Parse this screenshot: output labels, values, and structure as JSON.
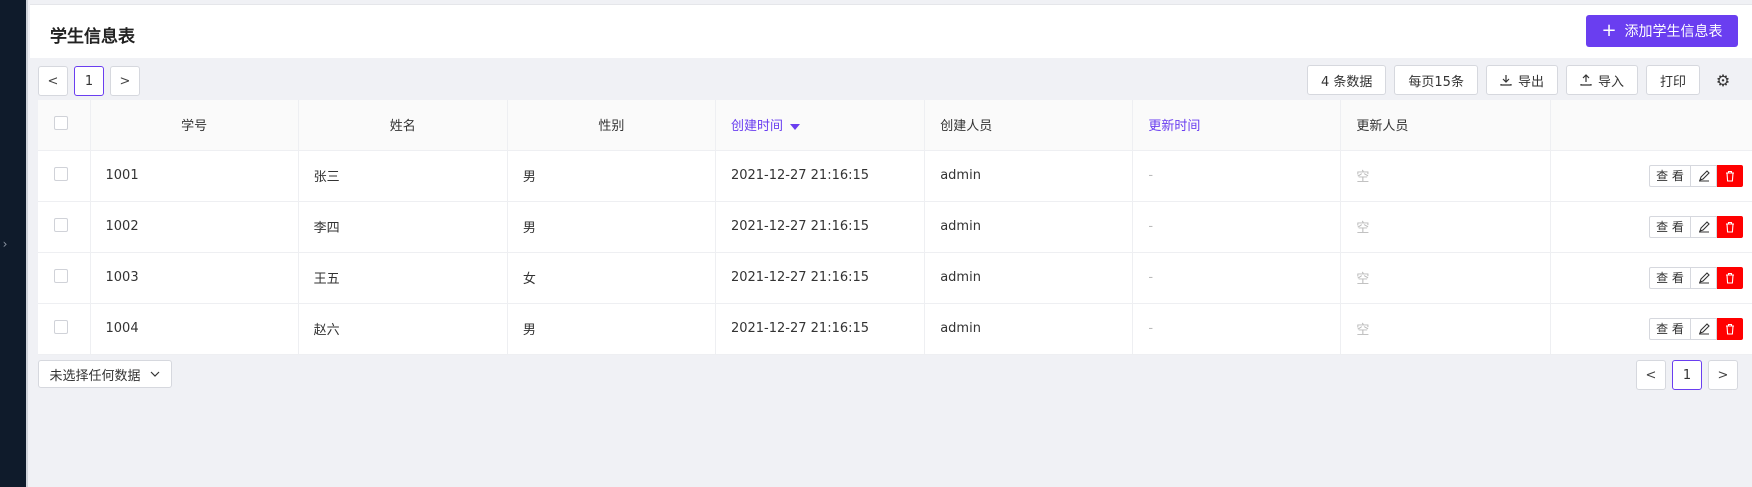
{
  "header": {
    "title": "学生信息表",
    "add_label": "添加学生信息表"
  },
  "pager": {
    "prev": "<",
    "page": "1",
    "next": ">"
  },
  "toolbar": {
    "count_label": "4 条数据",
    "per_page_label": "每页15条",
    "export_label": "导出",
    "import_label": "导入",
    "print_label": "打印"
  },
  "table": {
    "columns": [
      "学号",
      "姓名",
      "性别",
      "创建时间",
      "创建人员",
      "更新时间",
      "更新人员",
      ""
    ],
    "rows": [
      {
        "id": "1001",
        "name": "张三",
        "gender": "男",
        "created": "2021-12-27 21:16:15",
        "creator": "admin",
        "updated": "-",
        "updater": "空"
      },
      {
        "id": "1002",
        "name": "李四",
        "gender": "男",
        "created": "2021-12-27 21:16:15",
        "creator": "admin",
        "updated": "-",
        "updater": "空"
      },
      {
        "id": "1003",
        "name": "王五",
        "gender": "女",
        "created": "2021-12-27 21:16:15",
        "creator": "admin",
        "updated": "-",
        "updater": "空"
      },
      {
        "id": "1004",
        "name": "赵六",
        "gender": "男",
        "created": "2021-12-27 21:16:15",
        "creator": "admin",
        "updated": "-",
        "updater": "空"
      }
    ],
    "view_label": "查 看"
  },
  "footer": {
    "selection_label": "未选择任何数据"
  },
  "colors": {
    "accent": "#6a3ef0",
    "danger": "#ff0000"
  }
}
